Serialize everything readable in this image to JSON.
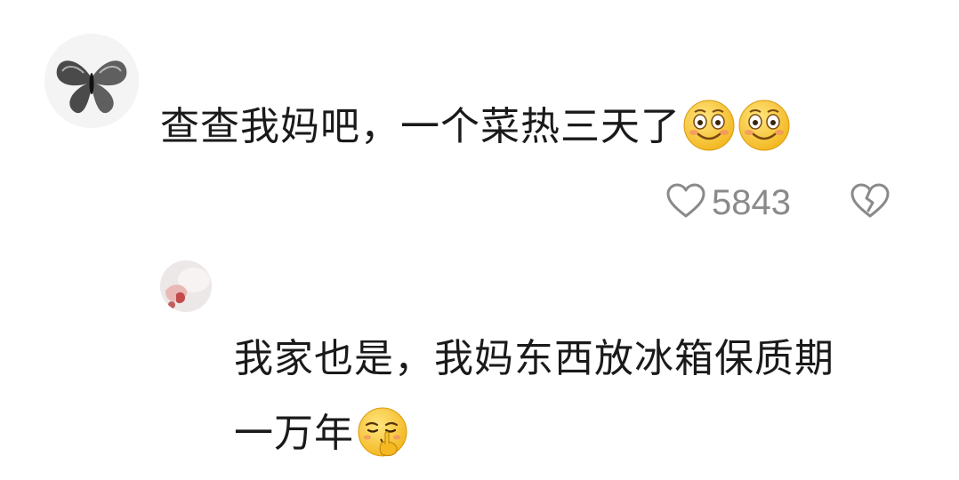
{
  "comments": [
    {
      "avatar_icon": "butterfly-ink-icon",
      "text": "查查我妈吧，一个菜热三天了",
      "emojis": [
        "smile-emoji",
        "smile-emoji"
      ],
      "like_count": "5843",
      "actions": {
        "like_icon": "heart-outline-icon",
        "dislike_icon": "broken-heart-icon"
      },
      "replies": [
        {
          "avatar_icon": "user-photo-avatar",
          "text_line1": "我家也是，我妈东西放冰箱保质期",
          "text_line2": "一万年",
          "emoji": "shush-emoji"
        }
      ]
    }
  ],
  "colors": {
    "text": "#1a1a1a",
    "meta": "#8a8a8a",
    "background": "#ffffff",
    "emoji_yellow": "#f7c431"
  }
}
